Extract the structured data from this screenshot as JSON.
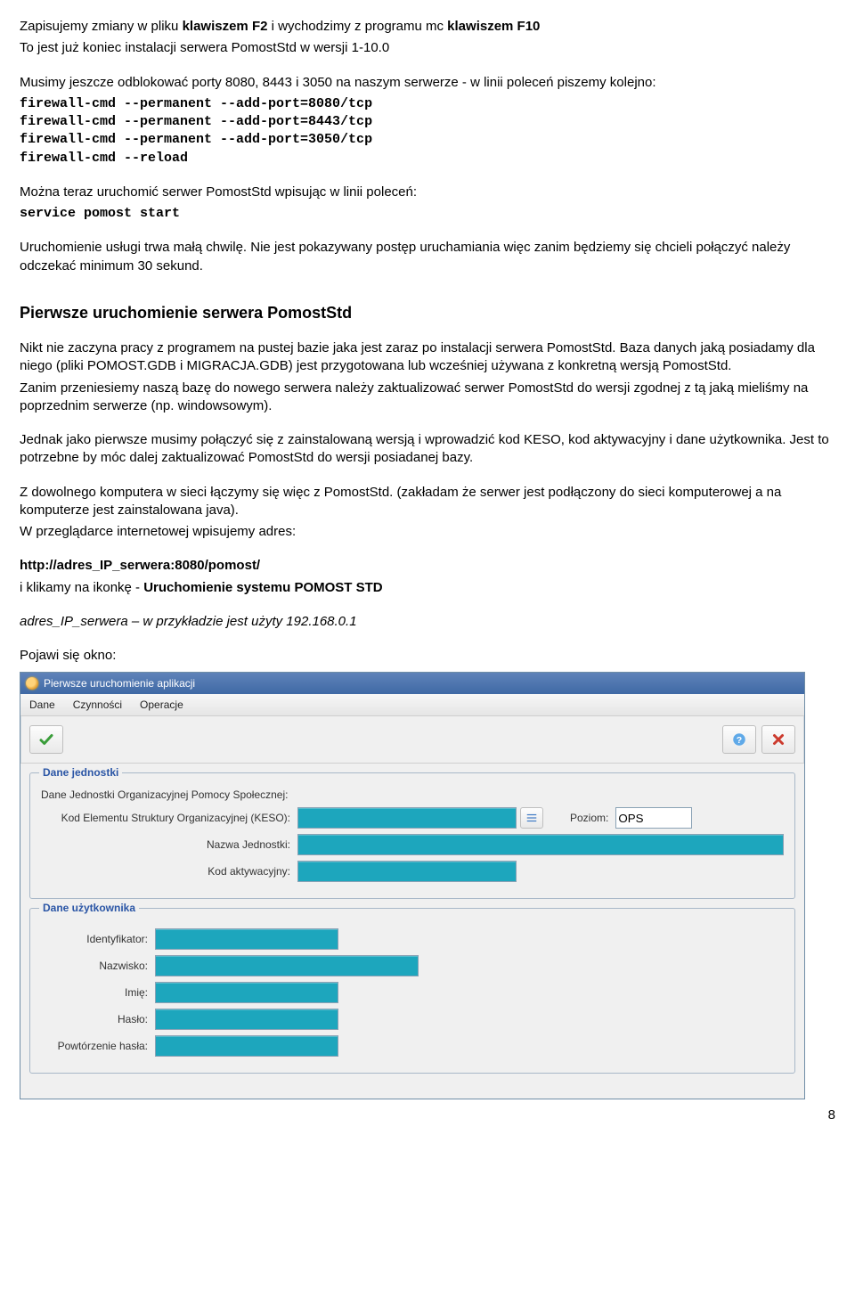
{
  "doc": {
    "p1a": "Zapisujemy zmiany w pliku ",
    "p1b": "klawiszem F2",
    "p1c": " i wychodzimy z programu mc ",
    "p1d": "klawiszem F10",
    "p2": "To jest już koniec instalacji serwera PomostStd w wersji 1-10.0",
    "p3": "Musimy jeszcze odblokować porty 8080, 8443 i 3050 na naszym serwerze - w linii poleceń piszemy kolejno:",
    "cmd1": "firewall-cmd --permanent --add-port=8080/tcp",
    "cmd2": "firewall-cmd --permanent --add-port=8443/tcp",
    "cmd3": "firewall-cmd --permanent --add-port=3050/tcp",
    "cmd4": "firewall-cmd --reload",
    "p4": "Można teraz uruchomić serwer PomostStd wpisując w linii poleceń:",
    "cmd5": "service pomost start",
    "p5": "Uruchomienie usługi trwa małą chwilę. Nie jest pokazywany postęp uruchamiania więc zanim będziemy się chcieli połączyć należy odczekać minimum 30 sekund.",
    "h1": "Pierwsze uruchomienie serwera PomostStd",
    "p6": "Nikt nie zaczyna pracy z programem na pustej bazie jaka jest zaraz po instalacji serwera PomostStd. Baza danych jaką posiadamy dla niego (pliki POMOST.GDB i MIGRACJA.GDB) jest przygotowana lub wcześniej używana z konkretną wersją PomostStd.",
    "p7": "Zanim przeniesiemy naszą bazę do nowego serwera należy zaktualizować serwer PomostStd do wersji zgodnej z tą jaką mieliśmy na poprzednim serwerze (np. windowsowym).",
    "p8": "Jednak jako pierwsze musimy połączyć się z zainstalowaną wersją i wprowadzić kod KESO, kod aktywacyjny i dane użytkownika. Jest to potrzebne by móc dalej zaktualizować PomostStd do wersji posiadanej bazy.",
    "p9": "Z dowolnego komputera w sieci łączymy się więc z PomostStd. (zakładam że serwer jest podłączony do sieci komputerowej a na komputerze jest zainstalowana java).",
    "p10": "W przeglądarce internetowej wpisujemy adres:",
    "url": "http://adres_IP_serwera:8080/pomost/",
    "p11a": "i klikamy na ikonkę - ",
    "p11b": "Uruchomienie systemu POMOST STD",
    "p12": "adres_IP_serwera – w przykładzie jest użyty 192.168.0.1",
    "p13": "Pojawi się okno:",
    "page": "8"
  },
  "app": {
    "title": "Pierwsze uruchomienie aplikacji",
    "menu": {
      "m1": "Dane",
      "m2": "Czynności",
      "m3": "Operacje"
    },
    "group1": {
      "legend": "Dane jednostki",
      "desc": "Dane Jednostki Organizacyjnej Pomocy Społecznej:",
      "keso_label": "Kod Elementu Struktury Organizacyjnej (KESO):",
      "poziom_label": "Poziom:",
      "poziom_value": "OPS",
      "nazwa_label": "Nazwa Jednostki:",
      "kod_label": "Kod aktywacyjny:"
    },
    "group2": {
      "legend": "Dane użytkownika",
      "id_label": "Identyfikator:",
      "nazw_label": "Nazwisko:",
      "imie_label": "Imię:",
      "haslo_label": "Hasło:",
      "powt_label": "Powtórzenie hasła:"
    }
  }
}
